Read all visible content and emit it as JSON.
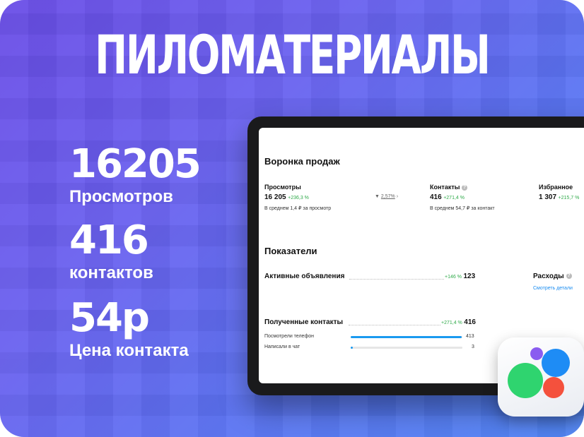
{
  "title": "ПИЛОМАТЕРИАЛЫ",
  "stats": [
    {
      "value": "16205",
      "label": "Просмотров"
    },
    {
      "value": "416",
      "label": "контактов"
    },
    {
      "value": "54р",
      "label": "Цена контакта"
    }
  ],
  "funnel": {
    "heading": "Воронка продаж",
    "views": {
      "label": "Просмотры",
      "value": "16 205",
      "change": "+236,3 %",
      "note": "В среднем 1,4 ₽ за просмотр"
    },
    "conversion": "2,57%",
    "contacts": {
      "label": "Контакты",
      "value": "416",
      "change": "+271,4 %",
      "note": "В среднем 54,7 ₽ за контакт"
    },
    "favorites": {
      "label": "Избранное",
      "value": "1 307",
      "change": "+215,7 %"
    }
  },
  "indicators": {
    "heading": "Показатели",
    "active_ads": {
      "label": "Активные объявления",
      "change": "+146 %",
      "value": "123"
    },
    "expenses": {
      "label": "Расходы",
      "link": "Смотреть детали"
    },
    "received": {
      "label": "Полученные контакты",
      "change": "+271,4 %",
      "value": "416"
    },
    "rows": [
      {
        "label": "Посмотрели телефон",
        "value": "413",
        "fraction": 0.993
      },
      {
        "label": "Написали в чат",
        "value": "3",
        "fraction": 0.02
      }
    ]
  },
  "colors": {
    "accent": "#1a9af0",
    "positive": "#2faa4a",
    "logo_green": "#2fd46f",
    "logo_blue": "#1e8cf5",
    "logo_red": "#f4513d",
    "logo_purple": "#8a5cf0"
  }
}
